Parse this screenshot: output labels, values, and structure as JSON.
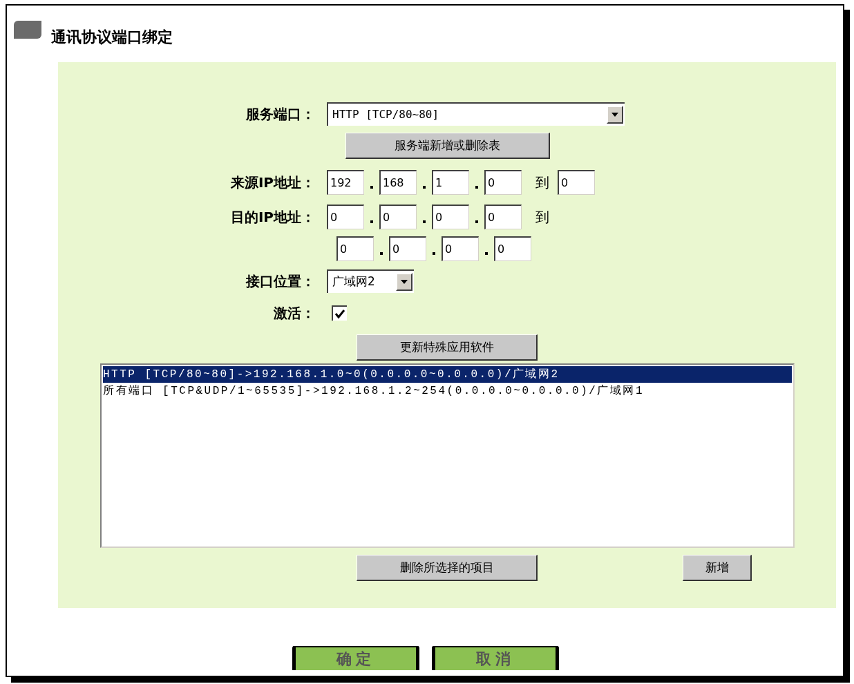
{
  "title": "通讯协议端口绑定",
  "form": {
    "service_port": {
      "label": "服务端口：",
      "value": "HTTP [TCP/80~80]"
    },
    "service_table_button": "服务端新增或删除表",
    "source_ip": {
      "label": "来源IP地址：",
      "octets": [
        "192",
        "168",
        "1",
        "0"
      ],
      "to_label": "到",
      "end": "0"
    },
    "destination_ip": {
      "label": "目的IP地址：",
      "start": [
        "0",
        "0",
        "0",
        "0"
      ],
      "to_label": "到",
      "end": [
        "0",
        "0",
        "0",
        "0"
      ]
    },
    "interface": {
      "label": "接口位置：",
      "value": "广域网2"
    },
    "active": {
      "label": "激活：",
      "checked": true
    },
    "update_button": "更新特殊应用软件"
  },
  "list": {
    "items": [
      {
        "text": "HTTP [TCP/80~80]->192.168.1.0~0(0.0.0.0~0.0.0.0)/广域网2",
        "selected": true
      },
      {
        "text": "所有端口 [TCP&UDP/1~65535]->192.168.1.2~254(0.0.0.0~0.0.0.0)/广域网1",
        "selected": false
      }
    ]
  },
  "delete_button": "删除所选择的项目",
  "add_button": "新增",
  "footer_buttons": [
    "确定",
    "取消"
  ]
}
